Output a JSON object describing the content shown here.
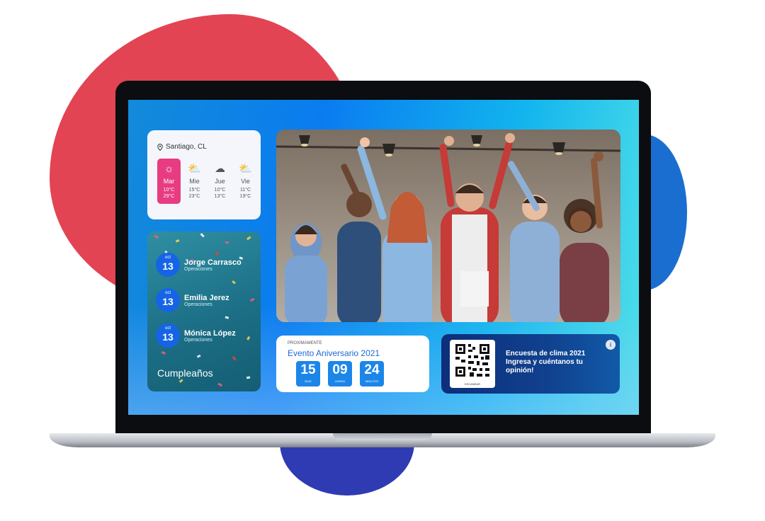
{
  "weather": {
    "location": "Santiago, CL",
    "days": [
      {
        "name": "Mar",
        "low": "10°C",
        "high": "29°C",
        "icon": "sun-icon",
        "active": true
      },
      {
        "name": "Mie",
        "low": "15°C",
        "high": "23°C",
        "icon": "partly-cloudy-icon"
      },
      {
        "name": "Jue",
        "low": "10°C",
        "high": "13°C",
        "icon": "cloudy-rain-icon"
      },
      {
        "name": "Vie",
        "low": "11°C",
        "high": "19°C",
        "icon": "partly-cloudy-icon"
      }
    ]
  },
  "birthdays": {
    "title": "Cumpleaños",
    "items": [
      {
        "month": "oct",
        "day": "13",
        "name": "Jorge Carrasco",
        "dept": "Operaciones"
      },
      {
        "month": "oct",
        "day": "13",
        "name": "Emilia Jerez",
        "dept": "Operaciones"
      },
      {
        "month": "oct",
        "day": "13",
        "name": "Mónica López",
        "dept": "Operaciones"
      }
    ]
  },
  "countdown": {
    "label": "PROXIMAMENTE",
    "title": "Evento Aniversario 2021",
    "units": [
      {
        "value": "15",
        "label": "DIAS"
      },
      {
        "value": "09",
        "label": "HORAS"
      },
      {
        "value": "24",
        "label": "MINUTOS"
      }
    ]
  },
  "survey": {
    "text": "Encuesta de clima 2021 Ingresa y cuéntanos tu opinión!",
    "qr_caption": "ESCANEAR"
  },
  "colors": {
    "accent_pink": "#e73c82",
    "brand_blue": "#1c86e8",
    "blob_red": "#e24454"
  }
}
